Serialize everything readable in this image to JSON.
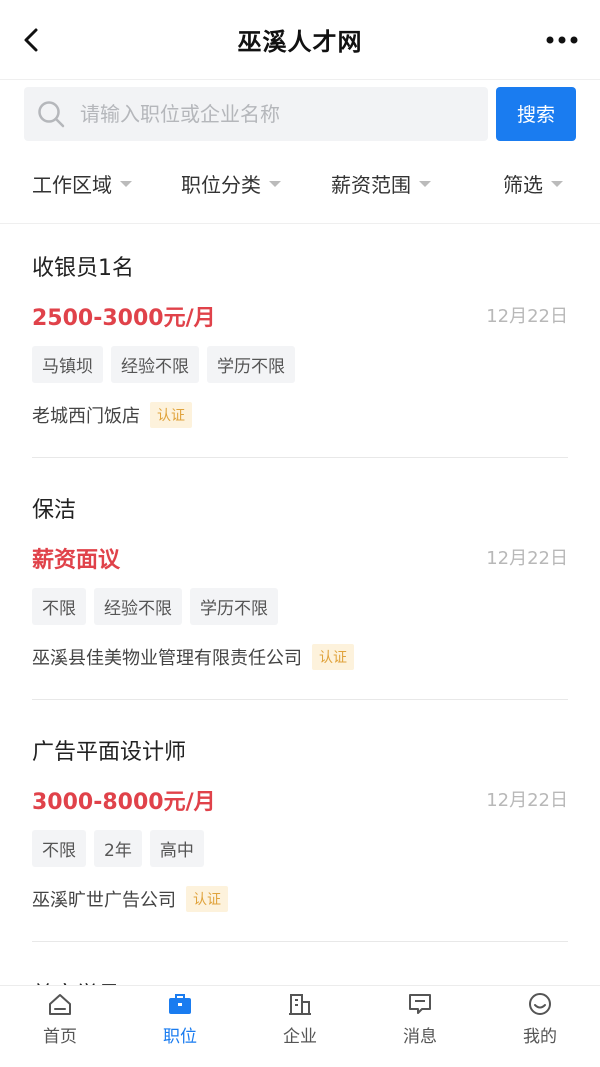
{
  "header": {
    "title": "巫溪人才网"
  },
  "search": {
    "placeholder": "请输入职位或企业名称",
    "button_label": "搜索"
  },
  "filters": [
    {
      "label": "工作区域"
    },
    {
      "label": "职位分类"
    },
    {
      "label": "薪资范围"
    },
    {
      "label": "筛选"
    }
  ],
  "jobs": [
    {
      "title": "收银员1名",
      "salary": "2500-3000元/月",
      "date": "12月22日",
      "tags": [
        "马镇坝",
        "经验不限",
        "学历不限"
      ],
      "company": "老城西门饭店",
      "badge": "认证"
    },
    {
      "title": "保洁",
      "salary": "薪资面议",
      "date": "12月22日",
      "tags": [
        "不限",
        "经验不限",
        "学历不限"
      ],
      "company": "巫溪县佳美物业管理有限责任公司",
      "badge": "认证"
    },
    {
      "title": "广告平面设计师",
      "salary": "3000-8000元/月",
      "date": "12月22日",
      "tags": [
        "不限",
        "2年",
        "高中"
      ],
      "company": "巫溪旷世广告公司",
      "badge": "认证"
    }
  ],
  "peek_job_title": "美容学员",
  "tabbar": {
    "items": [
      {
        "label": "首页",
        "icon": "home-icon"
      },
      {
        "label": "职位",
        "icon": "briefcase-icon",
        "active": true
      },
      {
        "label": "企业",
        "icon": "building-icon"
      },
      {
        "label": "消息",
        "icon": "message-icon"
      },
      {
        "label": "我的",
        "icon": "profile-icon"
      }
    ]
  },
  "colors": {
    "accent": "#1a7cf0",
    "salary": "#e0424a",
    "badge_bg": "#fdf2dc",
    "badge_text": "#e0a33c"
  }
}
